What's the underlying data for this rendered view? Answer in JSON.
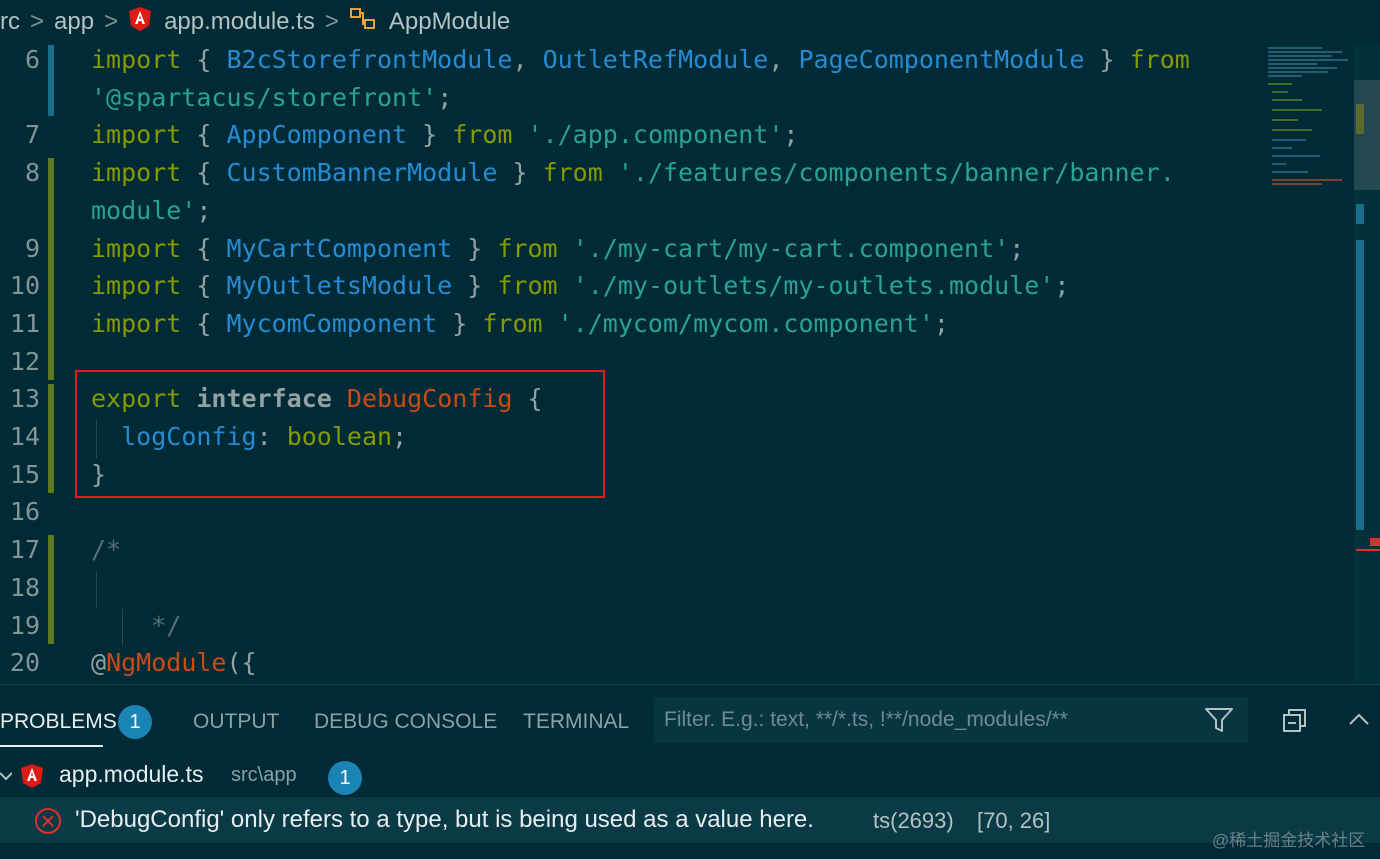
{
  "breadcrumb": {
    "items": [
      "rc",
      "app",
      "app.module.ts",
      "AppModule"
    ],
    "separator": ">"
  },
  "editor": {
    "lines": [
      {
        "n": "6",
        "tokens": [
          [
            "kw",
            "import"
          ],
          [
            "pun",
            " { "
          ],
          [
            "id",
            "B2cStorefrontModule"
          ],
          [
            "pun",
            ", "
          ],
          [
            "id",
            "OutletRefModule"
          ],
          [
            "pun",
            ", "
          ],
          [
            "id",
            "PageComponentModule"
          ],
          [
            "pun",
            " } "
          ],
          [
            "kw",
            "from"
          ]
        ]
      },
      {
        "n": "",
        "tokens": [
          [
            "str",
            "'@spartacus/storefront'"
          ],
          [
            "pun",
            ";"
          ]
        ]
      },
      {
        "n": "7",
        "tokens": [
          [
            "kw",
            "import"
          ],
          [
            "pun",
            " { "
          ],
          [
            "id",
            "AppComponent"
          ],
          [
            "pun",
            " } "
          ],
          [
            "kw",
            "from"
          ],
          [
            "pun",
            " "
          ],
          [
            "str",
            "'./app.component'"
          ],
          [
            "pun",
            ";"
          ]
        ]
      },
      {
        "n": "8",
        "tokens": [
          [
            "kw",
            "import"
          ],
          [
            "pun",
            " { "
          ],
          [
            "id",
            "CustomBannerModule"
          ],
          [
            "pun",
            " } "
          ],
          [
            "kw",
            "from"
          ],
          [
            "pun",
            " "
          ],
          [
            "str",
            "'./features/components/banner/banner."
          ]
        ]
      },
      {
        "n": "",
        "tokens": [
          [
            "str",
            "module'"
          ],
          [
            "pun",
            ";"
          ]
        ]
      },
      {
        "n": "9",
        "tokens": [
          [
            "kw",
            "import"
          ],
          [
            "pun",
            " { "
          ],
          [
            "id",
            "MyCartComponent"
          ],
          [
            "pun",
            " } "
          ],
          [
            "kw",
            "from"
          ],
          [
            "pun",
            " "
          ],
          [
            "str",
            "'./my-cart/my-cart.component'"
          ],
          [
            "pun",
            ";"
          ]
        ]
      },
      {
        "n": "10",
        "tokens": [
          [
            "kw",
            "import"
          ],
          [
            "pun",
            " { "
          ],
          [
            "id",
            "MyOutletsModule"
          ],
          [
            "pun",
            " } "
          ],
          [
            "kw",
            "from"
          ],
          [
            "pun",
            " "
          ],
          [
            "str",
            "'./my-outlets/my-outlets.module'"
          ],
          [
            "pun",
            ";"
          ]
        ]
      },
      {
        "n": "11",
        "tokens": [
          [
            "kw",
            "import"
          ],
          [
            "pun",
            " { "
          ],
          [
            "id",
            "MycomComponent"
          ],
          [
            "pun",
            " } "
          ],
          [
            "kw",
            "from"
          ],
          [
            "pun",
            " "
          ],
          [
            "str",
            "'./mycom/mycom.component'"
          ],
          [
            "pun",
            ";"
          ]
        ]
      },
      {
        "n": "12",
        "tokens": []
      },
      {
        "n": "13",
        "tokens": [
          [
            "kw",
            "export"
          ],
          [
            "pun",
            " "
          ],
          [
            "kwb",
            "interface"
          ],
          [
            "pun",
            " "
          ],
          [
            "cls",
            "DebugConfig"
          ],
          [
            "pun",
            " {"
          ]
        ]
      },
      {
        "n": "14",
        "tokens": [
          [
            "pun",
            "  "
          ],
          [
            "id",
            "logConfig"
          ],
          [
            "pun",
            ": "
          ],
          [
            "kw",
            "boolean"
          ],
          [
            "pun",
            ";"
          ]
        ]
      },
      {
        "n": "15",
        "tokens": [
          [
            "pun",
            "}"
          ]
        ]
      },
      {
        "n": "16",
        "tokens": []
      },
      {
        "n": "17",
        "tokens": [
          [
            "com",
            "/*"
          ]
        ]
      },
      {
        "n": "18",
        "tokens": []
      },
      {
        "n": "19",
        "tokens": [
          [
            "com",
            "    */"
          ]
        ]
      },
      {
        "n": "20",
        "tokens": [
          [
            "pun",
            "@"
          ],
          [
            "cls",
            "NgModule"
          ],
          [
            "pun",
            "({"
          ]
        ]
      }
    ]
  },
  "panel": {
    "tabs": [
      {
        "label": "PROBLEMS",
        "active": true
      },
      {
        "label": "OUTPUT",
        "active": false
      },
      {
        "label": "DEBUG CONSOLE",
        "active": false
      },
      {
        "label": "TERMINAL",
        "active": false
      }
    ],
    "problems_count": "1",
    "filter_placeholder": "Filter. E.g.: text, **/*.ts, !**/node_modules/**",
    "file": {
      "name": "app.module.ts",
      "path": "src\\app",
      "count": "1"
    },
    "problem": {
      "message": "'DebugConfig' only refers to a type, but is being used as a value here.",
      "code": "ts(2693)",
      "position": "[70, 26]"
    }
  },
  "watermark": "@稀土掘金技术社区",
  "colors": {
    "background": "#002b36",
    "keyword": "#859900",
    "identifier": "#268bd2",
    "string": "#2aa198",
    "class": "#cb4b16",
    "highlight_box": "#e11d1d",
    "badge": "#1a85b5",
    "error": "#dc322f"
  },
  "icons": [
    "angular-icon",
    "symbol-class-icon",
    "filter-icon",
    "collapse-all-icon",
    "chevron-up-icon",
    "chevron-down-icon",
    "error-icon"
  ]
}
